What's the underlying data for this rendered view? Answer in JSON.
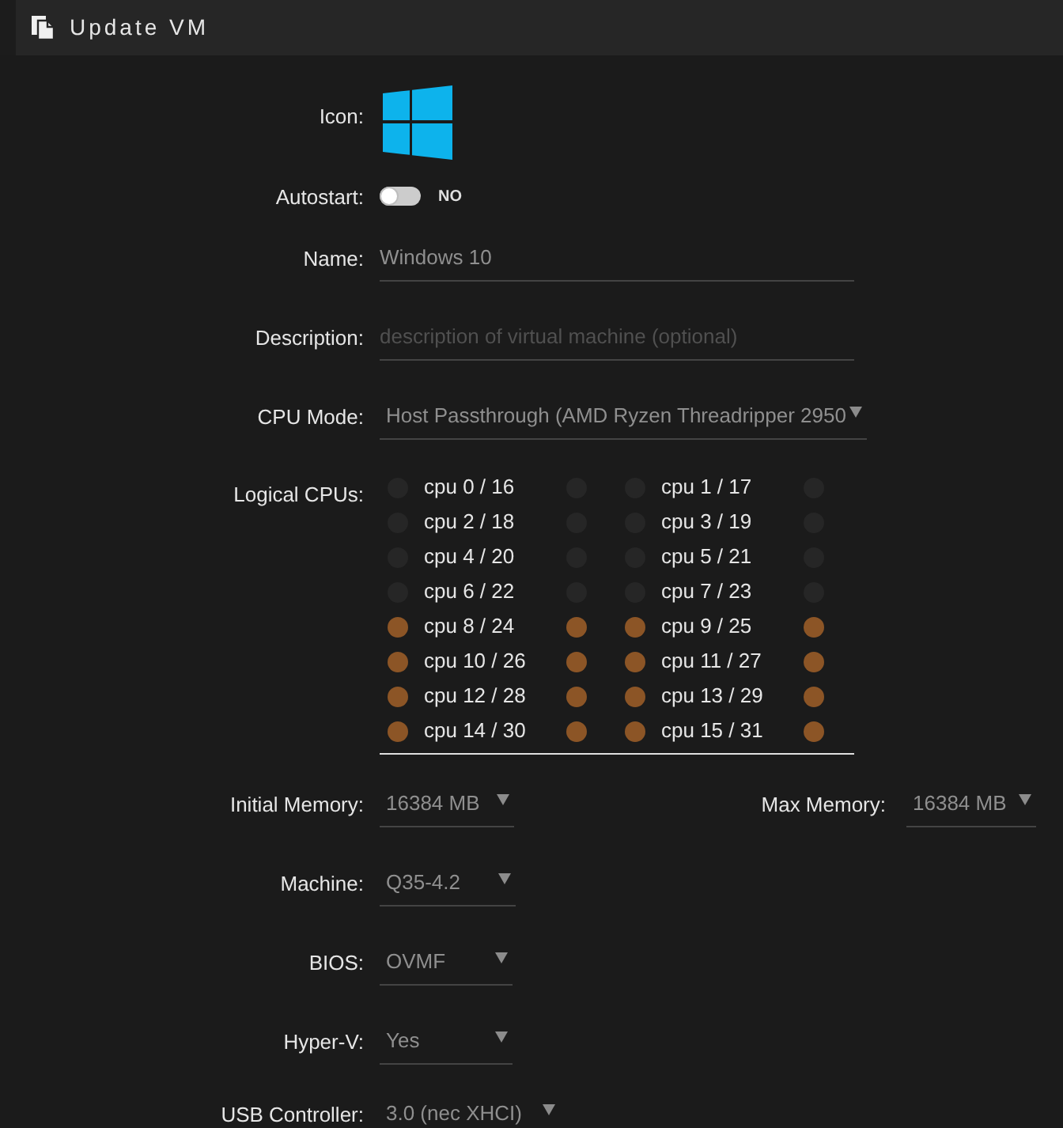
{
  "header": {
    "title": "Update VM"
  },
  "form": {
    "icon": {
      "label": "Icon:"
    },
    "autostart": {
      "label": "Autostart:",
      "on": false,
      "state_label": "NO"
    },
    "name": {
      "label": "Name:",
      "value": "Windows 10"
    },
    "description": {
      "label": "Description:",
      "placeholder": "description of virtual machine (optional)"
    },
    "cpu_mode": {
      "label": "CPU Mode:",
      "value": "Host Passthrough (AMD Ryzen Threadripper 2950"
    },
    "logical_cpus": {
      "label": "Logical CPUs:",
      "cores": [
        {
          "label": "cpu 0 / 16",
          "threads": [
            {
              "checked": false
            },
            {
              "checked": false
            }
          ]
        },
        {
          "label": "cpu 1 / 17",
          "threads": [
            {
              "checked": false
            },
            {
              "checked": false
            }
          ]
        },
        {
          "label": "cpu 2 / 18",
          "threads": [
            {
              "checked": false
            },
            {
              "checked": false
            }
          ]
        },
        {
          "label": "cpu 3 / 19",
          "threads": [
            {
              "checked": false
            },
            {
              "checked": false
            }
          ]
        },
        {
          "label": "cpu 4 / 20",
          "threads": [
            {
              "checked": false
            },
            {
              "checked": false
            }
          ]
        },
        {
          "label": "cpu 5 / 21",
          "threads": [
            {
              "checked": false
            },
            {
              "checked": false
            }
          ]
        },
        {
          "label": "cpu 6 / 22",
          "threads": [
            {
              "checked": false
            },
            {
              "checked": false
            }
          ]
        },
        {
          "label": "cpu 7 / 23",
          "threads": [
            {
              "checked": false
            },
            {
              "checked": false
            }
          ]
        },
        {
          "label": "cpu 8 / 24",
          "threads": [
            {
              "checked": true
            },
            {
              "checked": true
            }
          ]
        },
        {
          "label": "cpu 9 / 25",
          "threads": [
            {
              "checked": true
            },
            {
              "checked": true
            }
          ]
        },
        {
          "label": "cpu 10 / 26",
          "threads": [
            {
              "checked": true
            },
            {
              "checked": true
            }
          ]
        },
        {
          "label": "cpu 11 / 27",
          "threads": [
            {
              "checked": true
            },
            {
              "checked": true
            }
          ]
        },
        {
          "label": "cpu 12 / 28",
          "threads": [
            {
              "checked": true
            },
            {
              "checked": true
            }
          ]
        },
        {
          "label": "cpu 13 / 29",
          "threads": [
            {
              "checked": true
            },
            {
              "checked": true
            }
          ]
        },
        {
          "label": "cpu 14 / 30",
          "threads": [
            {
              "checked": true
            },
            {
              "checked": true
            }
          ]
        },
        {
          "label": "cpu 15 / 31",
          "threads": [
            {
              "checked": true
            },
            {
              "checked": true
            }
          ]
        }
      ]
    },
    "initial_memory": {
      "label": "Initial Memory:",
      "value": "16384 MB"
    },
    "max_memory": {
      "label": "Max Memory:",
      "value": "16384 MB"
    },
    "machine": {
      "label": "Machine:",
      "value": "Q35-4.2"
    },
    "bios": {
      "label": "BIOS:",
      "value": "OVMF"
    },
    "hyper_v": {
      "label": "Hyper-V:",
      "value": "Yes"
    },
    "usb_controller": {
      "label": "USB Controller:",
      "value": "3.0 (nec XHCI)"
    }
  }
}
